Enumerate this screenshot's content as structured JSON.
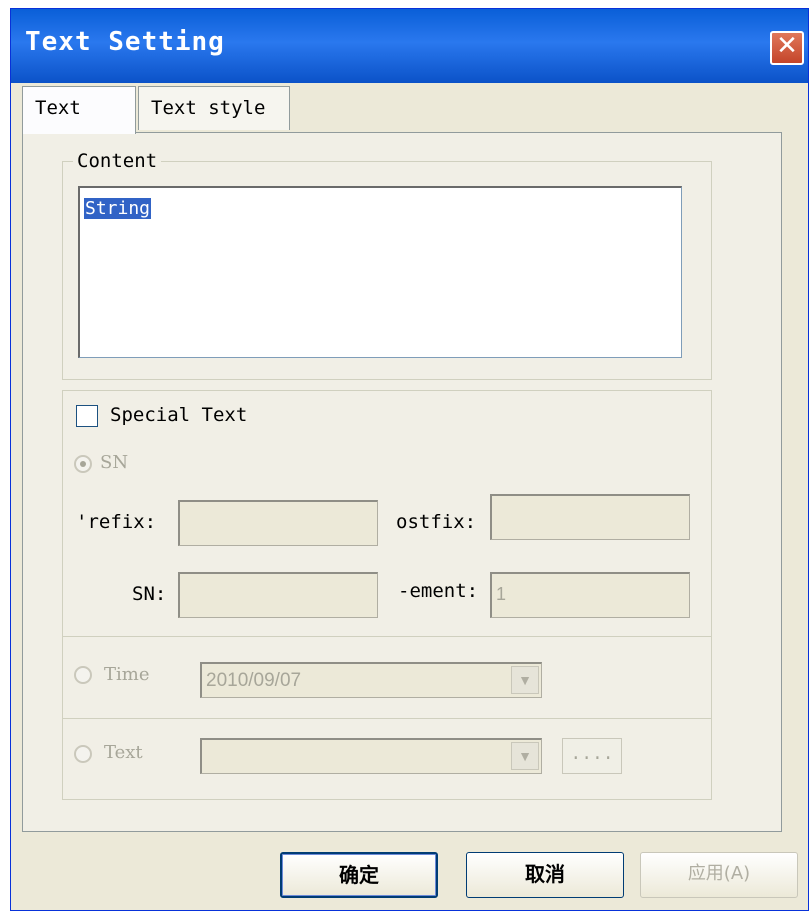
{
  "window": {
    "title": "Text Setting"
  },
  "tabs": [
    {
      "label": "Text",
      "active": true
    },
    {
      "label": "Text style",
      "active": false
    }
  ],
  "content": {
    "legend": "Content",
    "text": "String"
  },
  "special": {
    "checkbox_label": "Special Text",
    "checked": false,
    "sn_radio_label": "SN",
    "prefix_label": "'refix:",
    "postfix_label": "ostfix:",
    "sn_label": "SN:",
    "increment_label": "-ement:",
    "prefix_value": "",
    "postfix_value": "",
    "sn_value": "",
    "increment_value": "1",
    "time_radio_label": "Time",
    "time_value": "2010/09/07",
    "text_radio_label": "Text",
    "text_value": "",
    "browse_label": "...."
  },
  "buttons": {
    "ok": "确定",
    "cancel": "取消",
    "apply": "应用(A)"
  },
  "icons": {
    "close": "close-icon",
    "dropdown": "chevron-down-icon"
  },
  "colors": {
    "title_bar": "#0a5fd8",
    "close_button": "#c4452a",
    "selection": "#3163c6",
    "dialog_bg": "#ece9d8"
  }
}
